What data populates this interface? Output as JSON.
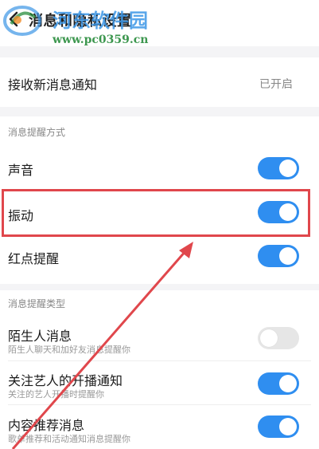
{
  "header": {
    "title": "消息和隐私设置",
    "watermark_title": "河东软件园",
    "watermark_url": "www.pc0359.cn"
  },
  "new_message": {
    "label": "接收新消息通知",
    "value": "已开启"
  },
  "section_reminder": {
    "title": "消息提醒方式",
    "items": [
      {
        "label": "声音",
        "enabled": true
      },
      {
        "label": "振动",
        "enabled": true
      },
      {
        "label": "红点提醒",
        "enabled": true
      }
    ]
  },
  "section_types": {
    "title": "消息提醒类型",
    "items": [
      {
        "label": "陌生人消息",
        "sub": "陌生人聊天和加好友消息提醒你",
        "enabled": false
      },
      {
        "label": "关注艺人的开播通知",
        "sub": "关注的艺人开播时提醒你",
        "enabled": true
      },
      {
        "label": "内容推荐消息",
        "sub": "歌单推荐和活动通知消息提醒你",
        "enabled": true
      }
    ]
  },
  "colors": {
    "toggle_on": "#2f8ef0",
    "toggle_off": "#e6e6e6",
    "annotation": "#e0474c"
  }
}
